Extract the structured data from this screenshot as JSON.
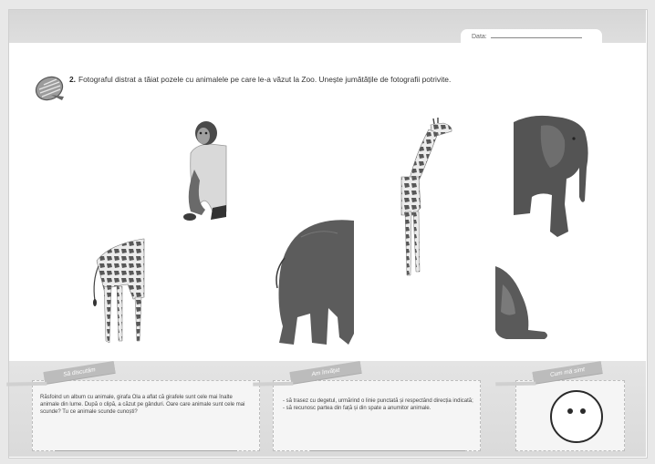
{
  "header": {
    "date_label": "Data:"
  },
  "exercise": {
    "icon": "shell-icon",
    "number": "2.",
    "text": "Fotograful distrat a tăiat pozele cu animalele pe care le-a văzut la Zoo. Unește jumătățile de fotografii potrivite."
  },
  "boxes": {
    "discuss": {
      "ribbon": "Să discutăm",
      "text": "Răsfoind un album cu animale, girafa Ola a aflat că girafele sunt cele mai înalte animale din lume. După o clipă, a căzut pe gânduri. Oare care animale sunt cele mai scunde? Tu ce animale scunde cunoști?"
    },
    "learned": {
      "ribbon": "Am învățat",
      "items": [
        "- să trasez cu degetul, urmărind o linie punctată și respectând direcția indicată;",
        "- să recunosc partea din față și din spate a anumitor animale."
      ]
    },
    "mood": {
      "ribbon": "Cum mă simt",
      "icon": "face-icon"
    }
  },
  "colors": {
    "page": "#ffffff",
    "band": "#dadada",
    "ribbon": "#bcbcbc",
    "text": "#333333"
  }
}
